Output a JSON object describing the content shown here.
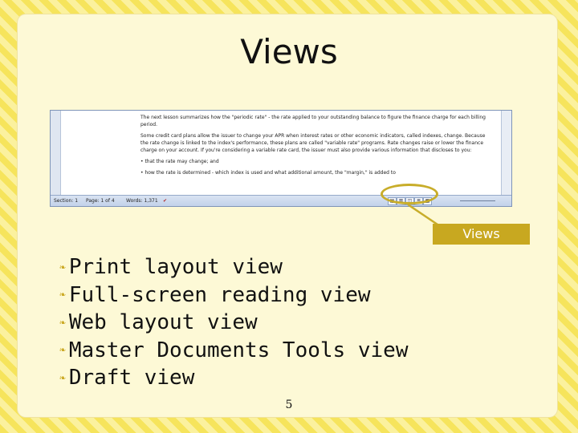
{
  "slide": {
    "title": "Views",
    "page_number": "5"
  },
  "screenshot": {
    "doc_paragraphs": [
      "The next lesson summarizes how the \"periodic rate\" - the rate applied to your outstanding balance to figure the finance charge for each billing period.",
      "Some credit card plans allow the issuer to change your APR when interest rates or other economic indicators, called indexes, change. Because the rate change is linked to the index's performance, these plans are called \"variable rate\" programs. Rate changes raise or lower the finance charge on your account. If you're considering a variable rate card, the issuer must also provide various information that discloses to you:",
      "that the rate may change; and",
      "how the rate is determined - which index is used and what additional amount, the \"margin,\" is added to"
    ],
    "status_bar": {
      "section": "Section: 1",
      "page": "Page: 1 of 4",
      "words": "Words: 1,371"
    }
  },
  "callout": {
    "label": "Views"
  },
  "bullets": [
    "Print layout view",
    "Full-screen reading view",
    "Web layout view",
    "Master Documents Tools view",
    "Draft view"
  ],
  "colors": {
    "accent": "#c8a820",
    "slide_background": "#fdf9d6",
    "frame_stripe_light": "#fbf19e",
    "frame_stripe_dark": "#f6e45c"
  }
}
